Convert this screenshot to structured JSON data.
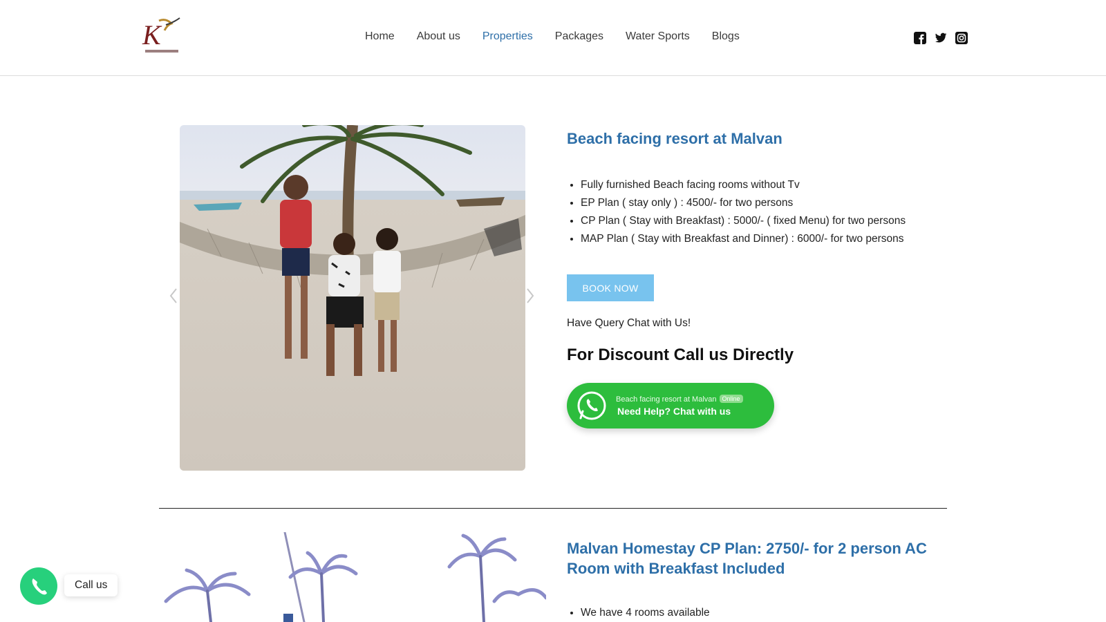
{
  "header": {
    "logo_icon": "malvan-resort-logo",
    "nav": [
      {
        "label": "Home",
        "active": false
      },
      {
        "label": "About us",
        "active": false
      },
      {
        "label": "Properties",
        "active": true
      },
      {
        "label": "Packages",
        "active": false
      },
      {
        "label": "Water Sports",
        "active": false
      },
      {
        "label": "Blogs",
        "active": false
      }
    ],
    "social_icons": [
      "facebook-icon",
      "twitter-icon",
      "instagram-icon"
    ]
  },
  "property1": {
    "title": "Beach facing resort at Malvan",
    "features": [
      "Fully furnished Beach facing rooms without Tv",
      "EP Plan ( stay only ) : 4500/- for two persons",
      "CP Plan ( Stay with Breakfast) : 5000/- ( fixed Menu) for two persons",
      "MAP Plan ( Stay with Breakfast and Dinner) : 6000/- for two persons"
    ],
    "book_button": "BOOK NOW",
    "query_text": "Have Query Chat with Us!",
    "discount_heading": "For Discount Call us Directly",
    "whatsapp": {
      "subtitle": "Beach facing resort at Malvan",
      "status": "Online",
      "cta": "Need Help? Chat with us"
    }
  },
  "property2": {
    "title": "Malvan Homestay CP Plan: 2750/- for 2 person AC Room with Breakfast Included",
    "features": [
      "We have 4 rooms available"
    ]
  },
  "call_widget": {
    "label": "Call us"
  },
  "colors": {
    "accent_blue": "#2e6fa8",
    "book_button": "#78c3ee",
    "whatsapp_green": "#2dbd3d",
    "call_green": "#27d07c"
  }
}
